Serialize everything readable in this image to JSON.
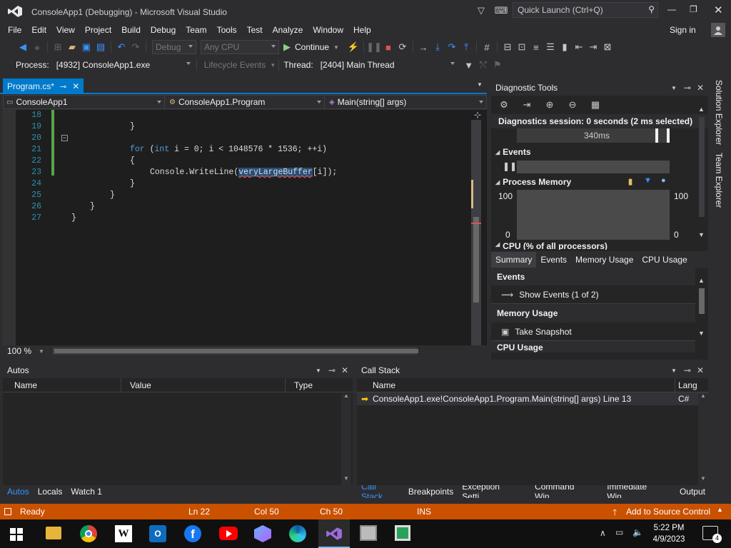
{
  "title": "ConsoleApp1 (Debugging) - Microsoft Visual Studio",
  "quick_launch": "Quick Launch (Ctrl+Q)",
  "menu": [
    "File",
    "Edit",
    "View",
    "Project",
    "Build",
    "Debug",
    "Team",
    "Tools",
    "Test",
    "Analyze",
    "Window",
    "Help"
  ],
  "sign_in": "Sign in",
  "toolbar": {
    "config": "Debug",
    "platform": "Any CPU",
    "continue": "Continue"
  },
  "process_bar": {
    "process_label": "Process:",
    "process": "[4932] ConsoleApp1.exe",
    "lifecycle": "Lifecycle Events",
    "thread_label": "Thread:",
    "thread": "[2404] Main Thread"
  },
  "editor": {
    "tab": "Program.cs*",
    "nav_project": "ConsoleApp1",
    "nav_class": "ConsoleApp1.Program",
    "nav_member": "Main(string[] args)",
    "line_numbers": [
      "18",
      "19",
      "20",
      "21",
      "22",
      "23",
      "24",
      "25",
      "26",
      "27"
    ],
    "code": {
      "l18": "}",
      "l20_kw1": "for",
      "l20_p1": " (",
      "l20_kw2": "int",
      "l20_rest": " i = 0; i < 1048576 * 1536; ++i)",
      "l21": "{",
      "l22_a": "Console.WriteLine(",
      "l22_sel": "veryLargeBuffer",
      "l22_b": "[i]);",
      "l23": "}",
      "l24": "}",
      "l25": "}",
      "l26": "}"
    },
    "zoom": "100 %"
  },
  "diag": {
    "title": "Diagnostic Tools",
    "session": "Diagnostics session: 0 seconds (2 ms selected)",
    "timeline": "340ms",
    "events": "Events",
    "process_memory": "Process Memory",
    "mem_max_left": "100",
    "mem_min_left": "0",
    "mem_max_right": "100",
    "mem_min_right": "0",
    "cpu": "CPU (% of all processors)",
    "tabs": [
      "Summary",
      "Events",
      "Memory Usage",
      "CPU Usage"
    ],
    "sec_events": "Events",
    "show_events": "Show Events (1 of 2)",
    "sec_memory": "Memory Usage",
    "snapshot": "Take Snapshot",
    "sec_cpu": "CPU Usage"
  },
  "side_tabs": [
    "Solution Explorer",
    "Team Explorer"
  ],
  "autos": {
    "title": "Autos",
    "cols": [
      "Name",
      "Value",
      "Type"
    ],
    "tabs": [
      "Autos",
      "Locals",
      "Watch 1"
    ]
  },
  "callstack": {
    "title": "Call Stack",
    "cols": [
      "Name",
      "Lang"
    ],
    "row_name": "ConsoleApp1.exe!ConsoleApp1.Program.Main(string[] args) Line 13",
    "row_lang": "C#",
    "tabs": [
      "Call Stack",
      "Breakpoints",
      "Exception Setti...",
      "Command Win...",
      "Immediate Win...",
      "Output"
    ]
  },
  "status": {
    "ready": "Ready",
    "ln": "Ln 22",
    "col": "Col 50",
    "ch": "Ch 50",
    "ins": "INS",
    "source": "Add to Source Control"
  },
  "taskbar": {
    "time": "5:22 PM",
    "date": "4/9/2023",
    "notif": "4"
  },
  "colors": {
    "accent": "#007acc",
    "status": "#ca5100",
    "debug_status": "#ca5100"
  }
}
